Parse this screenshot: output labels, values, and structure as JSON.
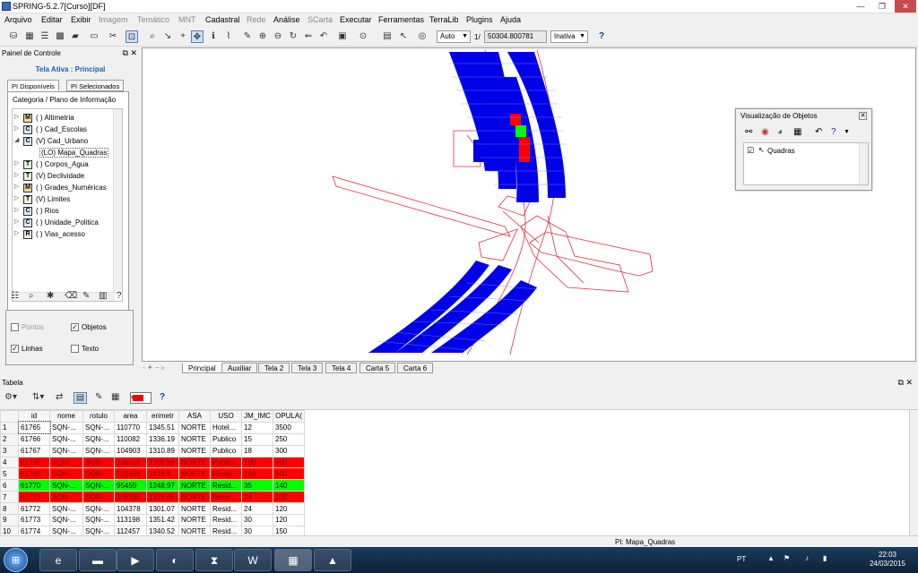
{
  "window": {
    "title": "SPRING-5.2.7[Curso][DF]",
    "minimize": "—",
    "maximize": "❐",
    "close": "✕"
  },
  "menu": [
    {
      "label": "Arquivo",
      "enabled": true
    },
    {
      "label": "Editar",
      "enabled": true
    },
    {
      "label": "Exibir",
      "enabled": true
    },
    {
      "label": "Imagem",
      "enabled": false
    },
    {
      "label": "Temático",
      "enabled": false
    },
    {
      "label": "MNT",
      "enabled": false
    },
    {
      "label": "Cadastral",
      "enabled": true
    },
    {
      "label": "Rede",
      "enabled": false
    },
    {
      "label": "Análise",
      "enabled": true
    },
    {
      "label": "SCarta",
      "enabled": false
    },
    {
      "label": "Executar",
      "enabled": true
    },
    {
      "label": "Ferramentas",
      "enabled": true
    },
    {
      "label": "TerraLib",
      "enabled": true
    },
    {
      "label": "Plugins",
      "enabled": true
    },
    {
      "label": "Ajuda",
      "enabled": true
    }
  ],
  "toolbar": {
    "zoom_mode": "Auto",
    "scale_prefix": "1/",
    "scale_value": "50304.800781",
    "state": "Inativa",
    "help_icon": "?"
  },
  "control_panel": {
    "title": "Painel de Controle",
    "active_screen": "Tela Ativa : Principal",
    "tabs": [
      "PI Disponíveis",
      "PI Selecionados"
    ],
    "tree_header": "Categoria / Plano de Informação",
    "tree": [
      {
        "cat": "M",
        "label": "( ) Altimetria",
        "expander": "▷",
        "indent": false,
        "selected": false
      },
      {
        "cat": "C",
        "label": "( ) Cad_Escolas",
        "expander": "▷",
        "indent": false,
        "selected": false
      },
      {
        "cat": "C",
        "label": "(V) Cad_Urbano",
        "expander": "◢",
        "indent": false,
        "selected": false
      },
      {
        "cat": "",
        "label": "(LO) Mapa_Quadras",
        "expander": "",
        "indent": true,
        "selected": true
      },
      {
        "cat": "T",
        "label": "( ) Corpos_Agua",
        "expander": "▷",
        "indent": false,
        "selected": false
      },
      {
        "cat": "T",
        "label": "(V) Declividade",
        "expander": "▷",
        "indent": false,
        "selected": false
      },
      {
        "cat": "M",
        "label": "( ) Grades_Numéricas",
        "expander": "▷",
        "indent": false,
        "selected": false
      },
      {
        "cat": "T",
        "label": "(V) Limites",
        "expander": "▷",
        "indent": false,
        "selected": false
      },
      {
        "cat": "C",
        "label": "( ) Rios",
        "expander": "▷",
        "indent": false,
        "selected": false
      },
      {
        "cat": "C",
        "label": "( ) Unidade_Politica",
        "expander": "▷",
        "indent": false,
        "selected": false
      },
      {
        "cat": "R",
        "label": "( ) Vias_acesso",
        "expander": "▷",
        "indent": false,
        "selected": false
      }
    ],
    "view_options": {
      "pontos": {
        "label": "Pontos",
        "checked": false,
        "enabled": false
      },
      "objetos": {
        "label": "Objetos",
        "checked": true,
        "enabled": true
      },
      "linhas": {
        "label": "Linhas",
        "checked": true,
        "enabled": true
      },
      "texto": {
        "label": "Texto",
        "checked": false,
        "enabled": true
      }
    }
  },
  "canvas_tabs": [
    "Principal",
    "Auxiliar",
    "Tela 2",
    "Tela 3",
    "Tela 4",
    "Carta 5",
    "Carta 6"
  ],
  "object_window": {
    "title": "Visualização de Objetos",
    "item_label": "Quadras",
    "item_checked": true
  },
  "table_panel": {
    "title": "Tabela",
    "columns": [
      "id",
      "nome",
      "rotulo",
      "area",
      "erimetr",
      "ASA",
      "USO",
      "JM_IMC",
      "OPULA("
    ],
    "rows": [
      {
        "n": "1",
        "cells": [
          "61765",
          "SQN-...",
          "SQN-...",
          "110770",
          "1345.51",
          "NORTE",
          "Hotel...",
          "12",
          "3500"
        ],
        "status": ""
      },
      {
        "n": "2",
        "cells": [
          "61766",
          "SQN-...",
          "SQN-...",
          "110082",
          "1336.19",
          "NORTE",
          "Publico",
          "15",
          "250"
        ],
        "status": ""
      },
      {
        "n": "3",
        "cells": [
          "61767",
          "SQN-...",
          "SQN-...",
          "104903",
          "1310.89",
          "NORTE",
          "Publico",
          "18",
          "300"
        ],
        "status": ""
      },
      {
        "n": "4",
        "cells": [
          "61768",
          "SQN-...",
          "SQN-...",
          "106524",
          "1305.89",
          "NORTE",
          "Publico",
          "100",
          "400"
        ],
        "status": "red"
      },
      {
        "n": "5",
        "cells": [
          "61769",
          "SQN-...",
          "SQN-...",
          "101699",
          "1279.4",
          "NORTE",
          "Resid...",
          "120",
          "500"
        ],
        "status": "red"
      },
      {
        "n": "6",
        "cells": [
          "61770",
          "SQN-...",
          "SQN-...",
          "95459",
          "1248.97",
          "NORTE",
          "Resid...",
          "35",
          "140"
        ],
        "status": "green"
      },
      {
        "n": "7",
        "cells": [
          "61771",
          "SQN-...",
          "SQN-...",
          "108330",
          "1323.46",
          "NORTE",
          "Resid...",
          "24",
          "100"
        ],
        "status": "red"
      },
      {
        "n": "8",
        "cells": [
          "61772",
          "SQN-...",
          "SQN-...",
          "104378",
          "1301.07",
          "NORTE",
          "Resid...",
          "24",
          "120"
        ],
        "status": ""
      },
      {
        "n": "9",
        "cells": [
          "61773",
          "SQN-...",
          "SQN-...",
          "113198",
          "1351.42",
          "NORTE",
          "Resid...",
          "30",
          "120"
        ],
        "status": ""
      },
      {
        "n": "10",
        "cells": [
          "61774",
          "SQN-...",
          "SQN-...",
          "112457",
          "1340.52",
          "NORTE",
          "Resid...",
          "30",
          "150"
        ],
        "status": ""
      }
    ]
  },
  "status_bar": {
    "text": "PI: Mapa_Quadras"
  },
  "taskbar": {
    "apps": [
      "start",
      "internet-explorer",
      "file-explorer",
      "media-player",
      "firefox",
      "acrobat",
      "word",
      "spring",
      "terraview"
    ],
    "language": "PT",
    "time": "22:03",
    "date": "24/03/2015"
  },
  "colors": {
    "quadras_fill": "#0000e8",
    "selected_red": "#ff0000",
    "selected_green": "#00ff00",
    "lines": "#e03040"
  }
}
